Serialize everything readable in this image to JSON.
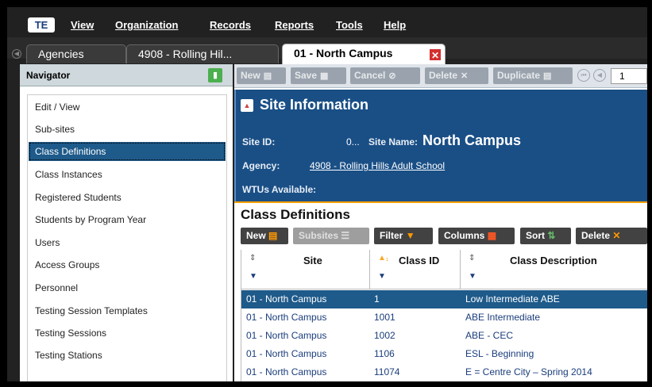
{
  "app": {
    "logo_text": "TE",
    "menu": [
      "View",
      "Organization",
      "Records",
      "Reports",
      "Tools",
      "Help"
    ]
  },
  "tabs": [
    {
      "label": "Agencies",
      "active": false
    },
    {
      "label": "4908 - Rolling Hil...",
      "active": false
    },
    {
      "label": "01 - North Campus",
      "active": true
    }
  ],
  "navigator": {
    "title": "Navigator",
    "items": [
      {
        "label": "Edit / View"
      },
      {
        "label": "Sub-sites"
      },
      {
        "label": "Class Definitions",
        "selected": true
      },
      {
        "label": "Class Instances"
      },
      {
        "label": "Registered Students"
      },
      {
        "label": "Students by Program Year"
      },
      {
        "label": "Users"
      },
      {
        "label": "Access Groups"
      },
      {
        "label": "Personnel"
      },
      {
        "label": "Testing Session Templates"
      },
      {
        "label": "Testing Sessions"
      },
      {
        "label": "Testing Stations"
      }
    ]
  },
  "toolbar": {
    "new": "New",
    "save": "Save",
    "cancel": "Cancel",
    "delete": "Delete",
    "duplicate": "Duplicate",
    "page": "1"
  },
  "site_info": {
    "heading": "Site Information",
    "site_id_label": "Site ID:",
    "site_id_value": "0...",
    "site_name_label": "Site Name:",
    "site_name_value": "North Campus",
    "agency_label": "Agency:",
    "agency_value": "4908 - Rolling Hills Adult School",
    "wtus_label": "WTUs Available:"
  },
  "class_definitions": {
    "title": "Class Definitions",
    "buttons": {
      "new": "New",
      "subsites": "Subsites",
      "filter": "Filter",
      "columns": "Columns",
      "sort": "Sort",
      "delete": "Delete"
    },
    "columns": [
      "Site",
      "Class ID",
      "Class Description"
    ],
    "rows": [
      {
        "site": "01 - North Campus",
        "class_id": "1",
        "description": "Low Intermediate ABE",
        "selected": true
      },
      {
        "site": "01 - North Campus",
        "class_id": "1001",
        "description": "ABE Intermediate"
      },
      {
        "site": "01 - North Campus",
        "class_id": "1002",
        "description": "ABE - CEC"
      },
      {
        "site": "01 - North Campus",
        "class_id": "1106",
        "description": "ESL - Beginning"
      },
      {
        "site": "01 - North Campus",
        "class_id": "11074",
        "description": "E = Centre City – Spring 2014"
      }
    ]
  }
}
